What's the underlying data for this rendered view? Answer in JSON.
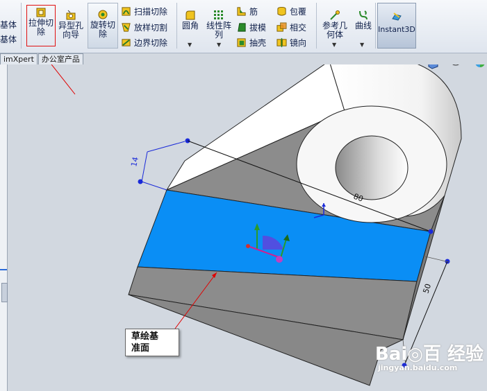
{
  "ribbon": {
    "partial_left": [
      "基体",
      "基体"
    ],
    "extrude_cut": [
      "拉伸切",
      "除"
    ],
    "hole_wizard": [
      "异型孔",
      "向导"
    ],
    "revolve_cut": [
      "旋转切",
      "除"
    ],
    "sweep_cut": "扫描切除",
    "loft_cut": "放样切割",
    "boundary_cut": "边界切除",
    "fillet": "圆角",
    "linear_pattern": [
      "线性阵",
      "列"
    ],
    "rib": "筋",
    "draft": "拔模",
    "shell": "抽壳",
    "wrap": "包覆",
    "intersect": "相交",
    "mirror": "镜向",
    "ref_geometry": [
      "参考几",
      "何体"
    ],
    "curves": "曲线",
    "instant3d": "Instant3D"
  },
  "tabs": [
    "imXpert",
    "办公室产品"
  ],
  "dims": {
    "d14": "14",
    "d80": "80",
    "d50": "50"
  },
  "callout": [
    "草绘基",
    "准面"
  ],
  "watermark": {
    "logo": "Bai◎百 经验",
    "url": "jingyan.baidu.com"
  },
  "colors": {
    "highlight": "#0a8ef5",
    "body": "#898989",
    "canvas_bg": "#d2d8e0",
    "annotation": "#e00000"
  }
}
